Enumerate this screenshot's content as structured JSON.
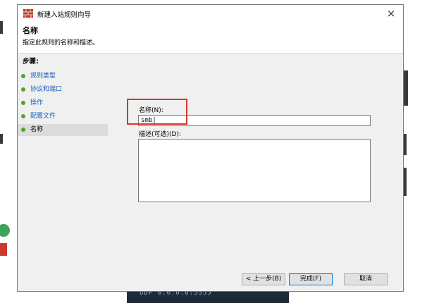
{
  "window": {
    "title": "新建入站规则向导",
    "close_glyph": "×"
  },
  "header": {
    "title": "名称",
    "subtitle": "指定此规则的名称和描述。"
  },
  "steps": {
    "heading": "步骤:",
    "items": [
      {
        "label": "规则类型",
        "current": false
      },
      {
        "label": "协议和端口",
        "current": false
      },
      {
        "label": "操作",
        "current": false
      },
      {
        "label": "配置文件",
        "current": false
      },
      {
        "label": "名称",
        "current": true
      }
    ]
  },
  "form": {
    "name_label": "名称(N):",
    "name_value": "smb|",
    "description_label": "描述(可选)(D):",
    "description_value": ""
  },
  "buttons": {
    "back": "< 上一步(B)",
    "finish": "完成(F)",
    "cancel": "取消"
  },
  "background": {
    "terminal_text": "UDP   0.0.0.0:5355"
  },
  "colors": {
    "step_dot": "#5aa02c",
    "step_link": "#1a5fb4",
    "highlight_box": "#d93434"
  }
}
